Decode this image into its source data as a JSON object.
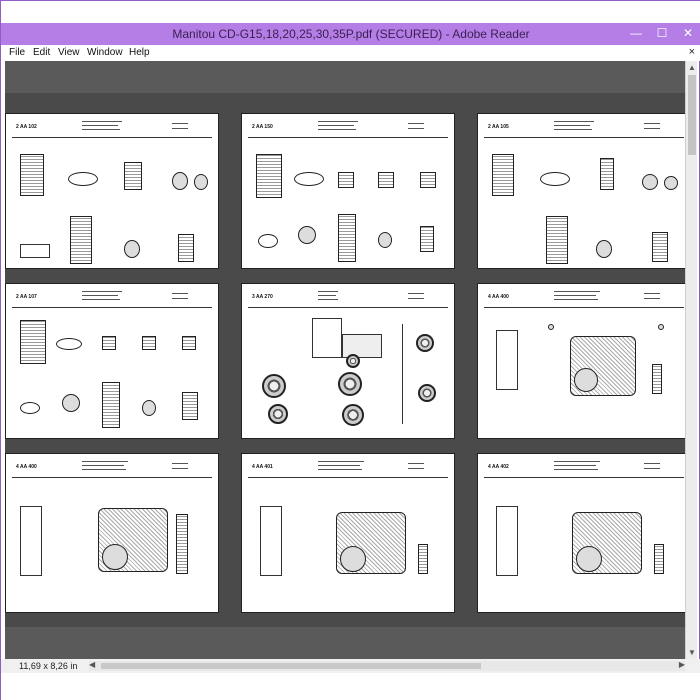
{
  "window": {
    "title": "Manitou CD-G15,18,20,25,30,35P.pdf (SECURED) - Adobe Reader",
    "minimize_glyph": "—",
    "maximize_glyph": "☐",
    "close_glyph": "✕"
  },
  "menu": {
    "items": [
      "File",
      "Edit",
      "View",
      "Window",
      "Help"
    ],
    "doc_close": "×"
  },
  "status": {
    "page_size": "11,69 x 8,26 in"
  },
  "scroll": {
    "left_arrow": "◀",
    "right_arrow": "▶",
    "up_arrow": "▲",
    "down_arrow": "▼"
  },
  "pages": [
    {
      "code": "2 AA 102"
    },
    {
      "code": "2 AA 150"
    },
    {
      "code": "2 AA 105"
    },
    {
      "code": "2 AA 107"
    },
    {
      "code": "3 AA 270"
    },
    {
      "code": "4 AA 400"
    },
    {
      "code": "4 AA 400"
    },
    {
      "code": "4 AA 401"
    },
    {
      "code": "4 AA 402"
    }
  ]
}
